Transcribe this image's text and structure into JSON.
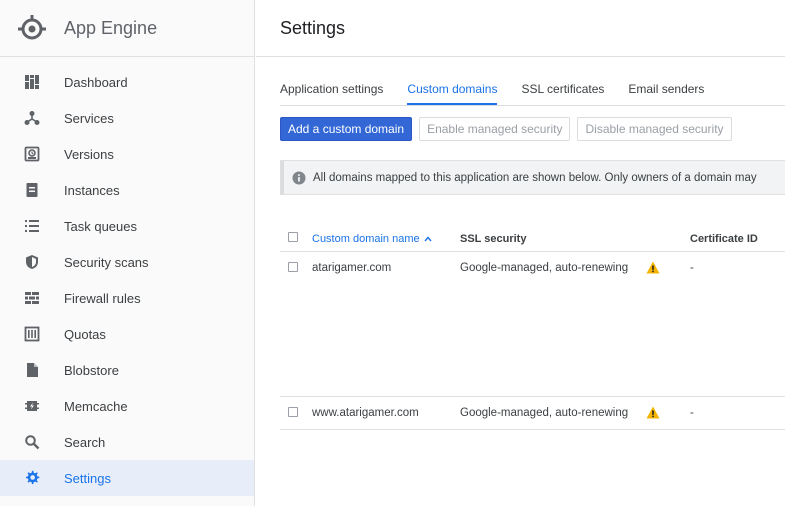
{
  "sidebar": {
    "app_title": "App Engine",
    "items": [
      {
        "label": "Dashboard",
        "icon": "dashboard-icon"
      },
      {
        "label": "Services",
        "icon": "services-icon"
      },
      {
        "label": "Versions",
        "icon": "versions-icon"
      },
      {
        "label": "Instances",
        "icon": "instances-icon"
      },
      {
        "label": "Task queues",
        "icon": "task-queues-icon"
      },
      {
        "label": "Security scans",
        "icon": "shield-icon"
      },
      {
        "label": "Firewall rules",
        "icon": "firewall-icon"
      },
      {
        "label": "Quotas",
        "icon": "quotas-icon"
      },
      {
        "label": "Blobstore",
        "icon": "blobstore-icon"
      },
      {
        "label": "Memcache",
        "icon": "memcache-icon"
      },
      {
        "label": "Search",
        "icon": "search-icon"
      },
      {
        "label": "Settings",
        "icon": "gear-icon",
        "active": true
      }
    ]
  },
  "header": {
    "title": "Settings"
  },
  "tabs": [
    {
      "label": "Application settings"
    },
    {
      "label": "Custom domains",
      "active": true
    },
    {
      "label": "SSL certificates"
    },
    {
      "label": "Email senders"
    }
  ],
  "toolbar": {
    "add_label": "Add a custom domain",
    "enable_label": "Enable managed security",
    "disable_label": "Disable managed security"
  },
  "info": {
    "text": "All domains mapped to this application are shown below. Only owners of a domain may"
  },
  "table": {
    "columns": [
      "Custom domain name",
      "SSL security",
      "Certificate ID"
    ],
    "rows": [
      {
        "domain": "atarigamer.com",
        "ssl": "Google-managed, auto-renewing",
        "cert": "-"
      },
      {
        "domain": "www.atarigamer.com",
        "ssl": "Google-managed, auto-renewing",
        "cert": "-"
      }
    ]
  },
  "colors": {
    "accent": "#1a73e8",
    "primary_button": "#3367d6",
    "warning": "#f4b400"
  }
}
